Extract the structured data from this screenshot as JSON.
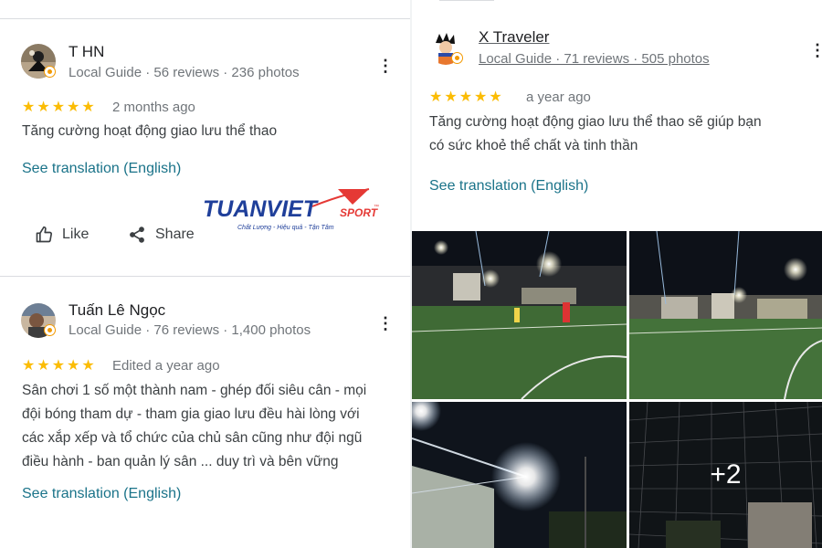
{
  "reviews": [
    {
      "name": "T HN",
      "meta": "Local Guide · 56 reviews · 236 photos",
      "stars": "★★★★★",
      "when": "2 months ago",
      "text": "Tăng cường hoạt động giao lưu thể thao",
      "translate": "See translation (English)",
      "like_label": "Like",
      "share_label": "Share"
    },
    {
      "name": "Tuấn Lê Ngọc",
      "meta": "Local Guide · 76 reviews · 1,400 photos",
      "stars": "★★★★★",
      "when": "Edited a year ago",
      "text_lines": [
        "Sân chơi 1 số một thành nam - ghép đối siêu cân - mọi",
        "đội bóng tham dự - tham gia giao lưu đều hài lòng với",
        "các xắp xếp và tổ chức của chủ sân cũng như đội ngũ",
        "điều hành - ban quản lý sân ... duy trì và bên vững"
      ],
      "translate": "See translation (English)"
    },
    {
      "name": "X Traveler",
      "meta": "Local Guide · 71 reviews · 505 photos",
      "stars": "★★★★★",
      "when": "a year ago",
      "text_lines": [
        "Tăng cường hoạt động giao lưu thể thao sẽ giúp bạn",
        "có sức khoẻ thể chất và tinh thần"
      ],
      "translate": "See translation (English)",
      "more_photos": "+2"
    }
  ],
  "logo": {
    "brand": "TUANVIET",
    "sub": "SPORT",
    "tm": "™",
    "tagline": "Chất Lượng - Hiệu quả - Tận Tâm"
  },
  "icons": {
    "more": "more-vertical-icon",
    "like": "thumbs-up-icon",
    "share": "share-icon",
    "badge": "local-guide-badge-icon"
  },
  "colors": {
    "star": "#fbbc04",
    "link": "#1a7389",
    "logo_blue": "#1f3f9a",
    "logo_red": "#e53935"
  }
}
